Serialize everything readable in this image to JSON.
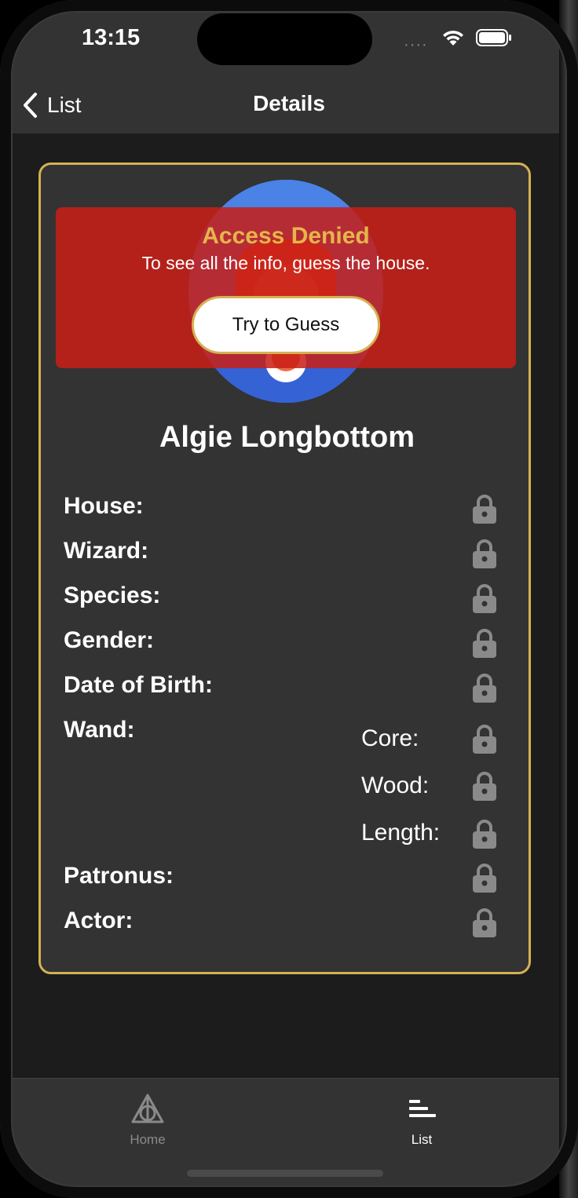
{
  "status_bar": {
    "time": "13:15",
    "signal": "····"
  },
  "nav": {
    "back_label": "List",
    "title": "Details"
  },
  "card": {
    "access_title": "Access Denied",
    "access_subtitle": "To see all the info, guess the house.",
    "guess_button": "Try to Guess",
    "character_name": "Algie Longbottom",
    "fields": {
      "house": "House:",
      "wizard": "Wizard:",
      "species": "Species:",
      "gender": "Gender:",
      "date_of_birth": "Date of Birth:",
      "wand": "Wand:",
      "wand_core": "Core:",
      "wand_wood": "Wood:",
      "wand_length": "Length:",
      "patronus": "Patronus:",
      "actor": "Actor:"
    },
    "lock_icon": "lock-icon"
  },
  "tab_bar": {
    "home_label": "Home",
    "list_label": "List",
    "selected": "List"
  },
  "colors": {
    "accent_gold": "#d4b252",
    "denied_red": "#c81e16",
    "avatar_blue": "#4a82e6",
    "background": "#1c1c1c",
    "surface": "#333333"
  }
}
